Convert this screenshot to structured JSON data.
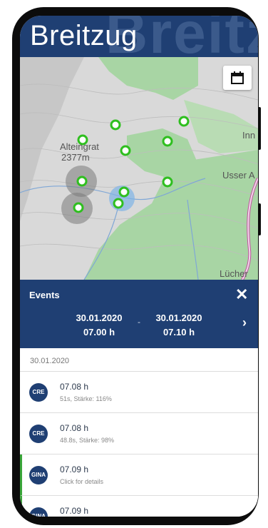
{
  "header": {
    "title": "Breitzug",
    "bg_text": "Breitzug"
  },
  "map": {
    "labels": {
      "peak_name": "Alteingrat",
      "peak_elevation": "2377m",
      "label_inn": "Inn",
      "label_usser": "Usser A",
      "label_lucher": "Lücher"
    },
    "calendar_button_icon": "calendar-icon",
    "marker_color": "#2fbf1f"
  },
  "events": {
    "title": "Events",
    "close_icon": "close-icon",
    "range": {
      "start_date": "30.01.2020",
      "start_time": "07.00 h",
      "separator": "-",
      "end_date": "30.01.2020",
      "end_time": "07.10 h"
    },
    "next_icon": "chevron-right-icon"
  },
  "list": {
    "day": "30.01.2020",
    "items": [
      {
        "badge": "CRE",
        "time": "07.08 h",
        "detail": "51s, Stärke: 116%"
      },
      {
        "badge": "CRE",
        "time": "07.08 h",
        "detail": "48.8s, Stärke: 98%"
      },
      {
        "badge": "GINA",
        "time": "07.09 h",
        "detail": "Click for details"
      },
      {
        "badge": "GINA",
        "time": "07.09 h",
        "detail": ""
      }
    ]
  },
  "colors": {
    "brand": "#1f3f73",
    "accent": "#3aa63a",
    "forest": "#a8d5a4"
  }
}
